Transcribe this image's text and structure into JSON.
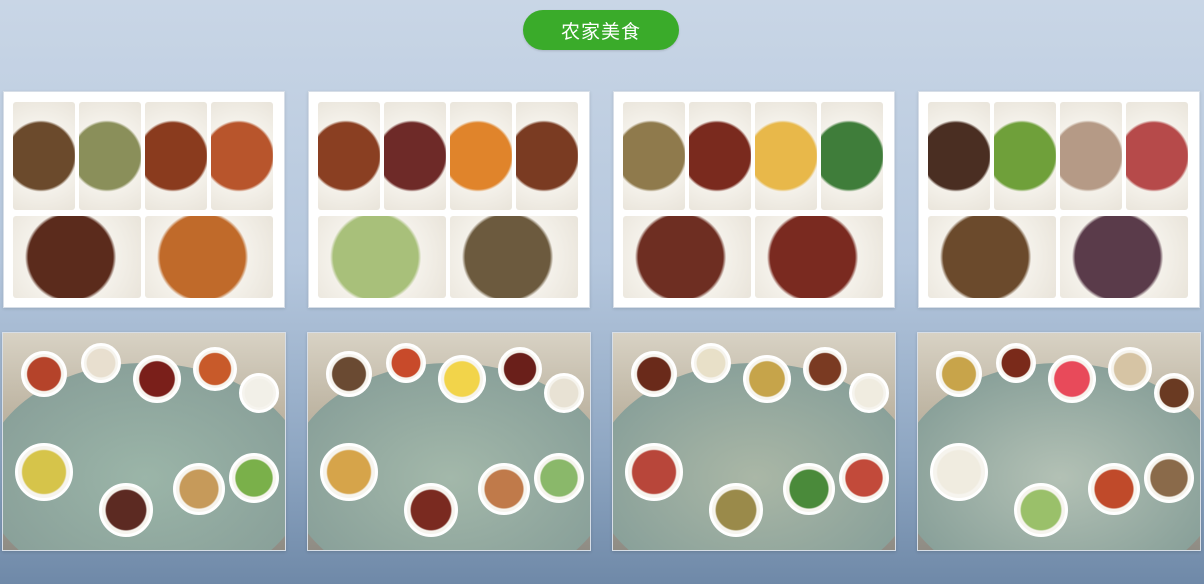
{
  "header": {
    "title": "农家美食"
  },
  "collages": [
    {
      "tiles": [
        "#6b4a2c",
        "#8a8f5a",
        "#8a3b1e",
        "#b8552c",
        "#5b2b1c",
        "#c06a2a"
      ]
    },
    {
      "tiles": [
        "#8a3f22",
        "#6e2a28",
        "#e0842b",
        "#7a3b22",
        "#a8c07a",
        "#6c5a3e"
      ]
    },
    {
      "tiles": [
        "#8f7a4c",
        "#7a2a1e",
        "#e8b84a",
        "#3f7d3a",
        "#6e2e22",
        "#7a2a20"
      ]
    },
    {
      "tiles": [
        "#4a2e22",
        "#6fa03a",
        "#b59a86",
        "#b64a4a",
        "#6b4a2c",
        "#5a3b4a"
      ]
    }
  ],
  "photos": [
    {
      "name": "banquet-table-1",
      "table": "#9bb5a8",
      "plates": [
        "#b5432a",
        "#e8dfcf",
        "#7a1f1a",
        "#c85a2a",
        "#f2f0e8",
        "#d6c44a",
        "#5c2a22",
        "#c69a5a",
        "#7ab04a"
      ]
    },
    {
      "name": "banquet-table-2",
      "table": "#a3b8aa",
      "plates": [
        "#6a4a32",
        "#c84a2a",
        "#f2d44a",
        "#6a1f1a",
        "#e8e2d4",
        "#d6a44a",
        "#7a2a20",
        "#c07a4a",
        "#8ab86a"
      ]
    },
    {
      "name": "family-dinner",
      "table": "#aab7a6",
      "plates": [
        "#6a2a1a",
        "#e8e0c8",
        "#c6a44a",
        "#7a3a22",
        "#f0ece0",
        "#b8463a",
        "#9a8a4a",
        "#4a8a3a",
        "#c24a3a"
      ]
    },
    {
      "name": "group-dinner",
      "table": "#b3c1b5",
      "plates": [
        "#c8a44a",
        "#7a2a1a",
        "#e84a5a",
        "#d6c4a4",
        "#6a3a22",
        "#f0ece0",
        "#9ac06a",
        "#c04a2a",
        "#8a6a4a"
      ]
    }
  ]
}
